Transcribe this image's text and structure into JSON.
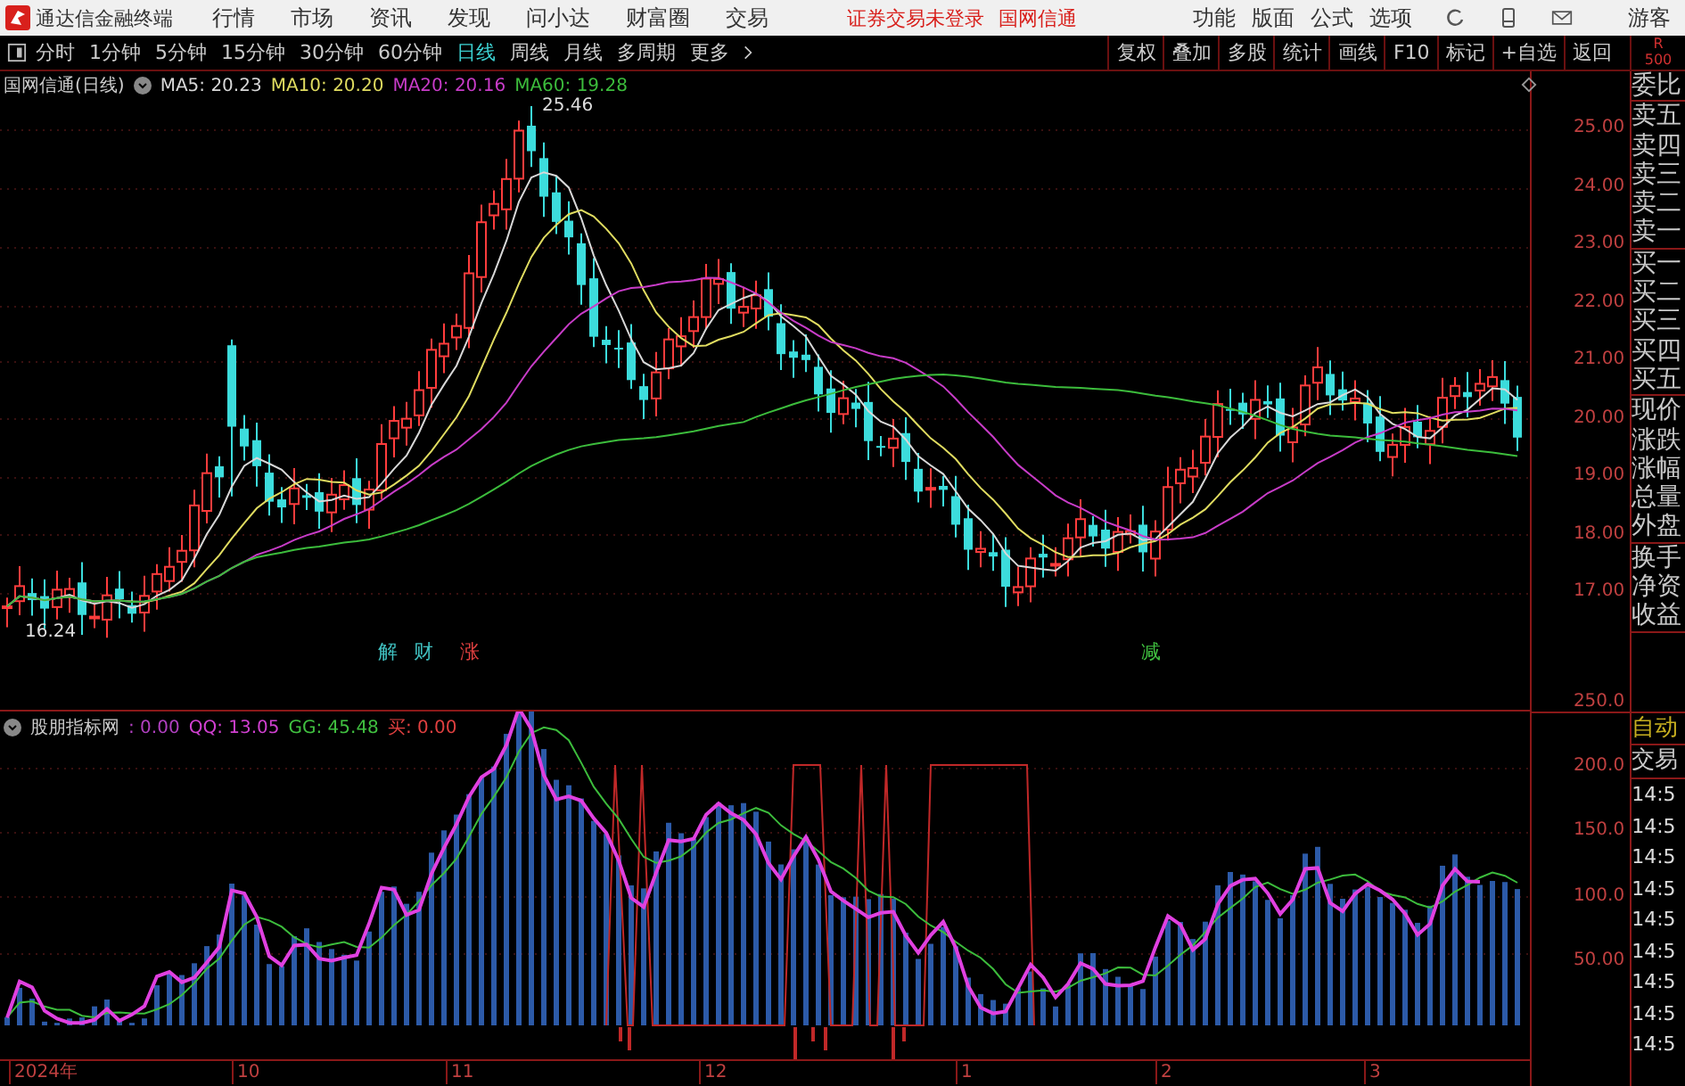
{
  "menu_bar": {
    "app_name": "通达信金融终端",
    "menus": [
      "行情",
      "市场",
      "资讯",
      "发现",
      "问小达",
      "财富圈",
      "交易"
    ],
    "login_status": "证券交易未登录",
    "stock_link": "国网信通",
    "tools": [
      "功能",
      "版面",
      "公式",
      "选项"
    ],
    "user": "游客"
  },
  "period_tabs": [
    {
      "label": "分时",
      "selected": false
    },
    {
      "label": "1分钟",
      "selected": false
    },
    {
      "label": "5分钟",
      "selected": false
    },
    {
      "label": "15分钟",
      "selected": false
    },
    {
      "label": "30分钟",
      "selected": false
    },
    {
      "label": "60分钟",
      "selected": false
    },
    {
      "label": "日线",
      "selected": true
    },
    {
      "label": "周线",
      "selected": false
    },
    {
      "label": "月线",
      "selected": false
    },
    {
      "label": "多周期",
      "selected": false
    },
    {
      "label": "更多",
      "selected": false
    }
  ],
  "chart_tools": [
    "复权",
    "叠加",
    "多股",
    "统计",
    "画线",
    "F10",
    "标记",
    "+自选",
    "返回"
  ],
  "level_badge": {
    "letter": "R",
    "number": "500"
  },
  "price_chart": {
    "title": "国网信通(日线)",
    "ma": [
      {
        "label": "MA5: 20.23",
        "color": "#d8d8d8"
      },
      {
        "label": "MA10: 20.20",
        "color": "#e0dc60"
      },
      {
        "label": "MA20: 20.16",
        "color": "#c83cc8"
      },
      {
        "label": "MA60: 19.28",
        "color": "#3cbc3c"
      }
    ],
    "high_label": "25.46",
    "low_label": "16.24",
    "ticks": [
      "25.00",
      "24.00",
      "23.00",
      "22.00",
      "21.00",
      "20.00",
      "19.00",
      "18.00",
      "17.00"
    ],
    "event_marks": [
      {
        "text": "解",
        "color": "#40c0c0"
      },
      {
        "text": "财",
        "color": "#40c0c0"
      },
      {
        "text": "涨",
        "color": "#e04040"
      },
      {
        "text": "减",
        "color": "#40c040"
      }
    ]
  },
  "quote_panel": [
    [
      "委比"
    ],
    [
      "卖五",
      "卖四",
      "卖三",
      "卖二",
      "卖一"
    ],
    [
      "买一",
      "买二",
      "买三",
      "买四",
      "买五"
    ],
    [
      "现价",
      "涨跌",
      "涨幅",
      "总量",
      "外盘"
    ],
    [
      "换手",
      "净资",
      "收益"
    ]
  ],
  "indicator": {
    "name": "股朋指标网",
    "values": [
      {
        "label": ": 0.00",
        "color": "#b040c0"
      },
      {
        "label": "QQ: 13.05",
        "color": "#d040d0"
      },
      {
        "label": "GG: 45.48",
        "color": "#40c040"
      },
      {
        "label": "买: 0.00",
        "color": "#e04040"
      }
    ],
    "ticks": [
      "250.0",
      "200.0",
      "150.0",
      "100.0",
      "50.00"
    ]
  },
  "trade_panel": {
    "mode": "自动",
    "header": "交易",
    "times": [
      "14:5",
      "14:5",
      "14:5",
      "14:5",
      "14:5",
      "14:5",
      "14:5",
      "14:5",
      "14:5"
    ]
  },
  "x_axis": [
    "2024年",
    "10",
    "11",
    "12",
    "1",
    "2",
    "3"
  ]
}
